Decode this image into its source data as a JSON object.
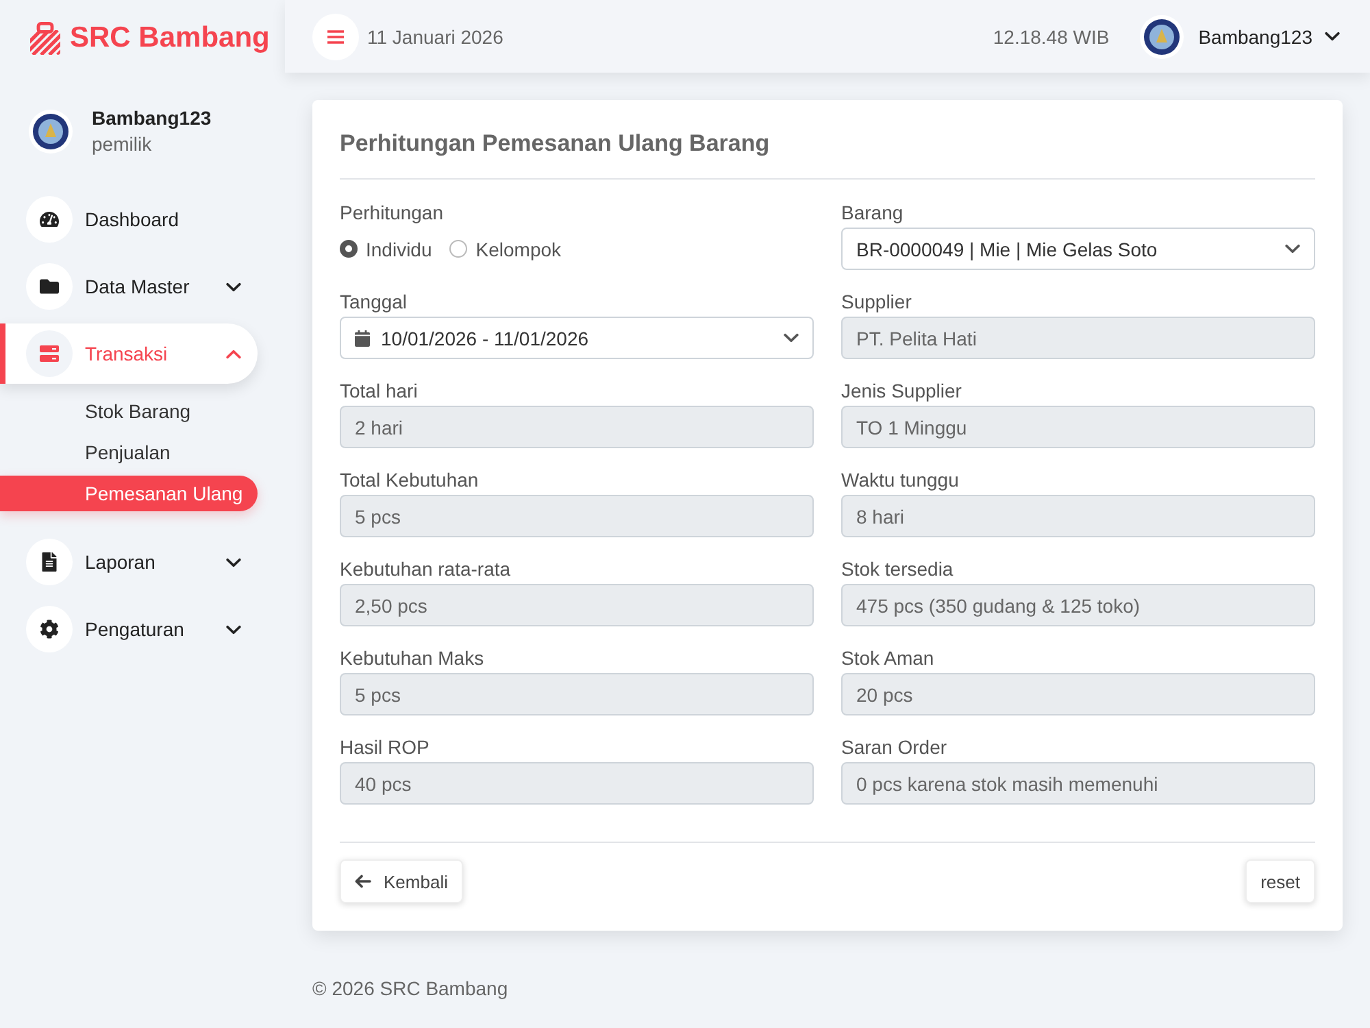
{
  "brand": {
    "name": "SRC Bambang"
  },
  "profile": {
    "name": "Bambang123",
    "role": "pemilik"
  },
  "sidebar": {
    "items": [
      {
        "label": "Dashboard",
        "selected": false
      },
      {
        "label": "Data Master",
        "selected": false,
        "expanded": false
      },
      {
        "label": "Transaksi",
        "selected": true,
        "expanded": true,
        "children": [
          {
            "label": "Stok Barang",
            "selected": false
          },
          {
            "label": "Penjualan",
            "selected": false
          },
          {
            "label": "Pemesanan Ulang",
            "selected": true
          }
        ]
      },
      {
        "label": "Laporan",
        "selected": false,
        "expanded": false
      },
      {
        "label": "Pengaturan",
        "selected": false,
        "expanded": false
      }
    ]
  },
  "topbar": {
    "date": "11 Januari 2026",
    "time": "12.18.48 WIB",
    "user": "Bambang123"
  },
  "form": {
    "title": "Perhitungan Pemesanan Ulang Barang",
    "fields": [
      {
        "label": "Perhitungan",
        "kind": "radio",
        "options": [
          {
            "label": "Individu",
            "selected": true
          },
          {
            "label": "Kelompok",
            "selected": false
          }
        ]
      },
      {
        "label": "Barang",
        "kind": "select",
        "value": "BR-0000049 | Mie | Mie Gelas Soto"
      },
      {
        "label": "Tanggal",
        "kind": "daterange",
        "value": "10/01/2026 - 11/01/2026"
      },
      {
        "label": "Supplier",
        "kind": "readonly",
        "value": "PT. Pelita Hati"
      },
      {
        "label": "Total hari",
        "kind": "readonly",
        "value": "2 hari"
      },
      {
        "label": "Jenis Supplier",
        "kind": "readonly",
        "value": "TO 1 Minggu"
      },
      {
        "label": "Total Kebutuhan",
        "kind": "readonly",
        "value": "5 pcs"
      },
      {
        "label": "Waktu tunggu",
        "kind": "readonly",
        "value": "8 hari"
      },
      {
        "label": "Kebutuhan rata-rata",
        "kind": "readonly",
        "value": "2,50 pcs"
      },
      {
        "label": "Stok tersedia",
        "kind": "readonly",
        "value": "475 pcs (350 gudang & 125 toko)"
      },
      {
        "label": "Kebutuhan Maks",
        "kind": "readonly",
        "value": "5 pcs"
      },
      {
        "label": "Stok Aman",
        "kind": "readonly",
        "value": "20 pcs"
      },
      {
        "label": "Hasil ROP",
        "kind": "readonly",
        "value": "40 pcs"
      },
      {
        "label": "Saran Order",
        "kind": "readonly",
        "value": "0 pcs karena stok masih memenuhi"
      }
    ],
    "buttons": [
      {
        "label": "Kembali",
        "kind": "back"
      },
      {
        "label": "reset",
        "kind": "plain"
      }
    ]
  },
  "footer": {
    "text": "© 2026 SRC Bambang"
  }
}
